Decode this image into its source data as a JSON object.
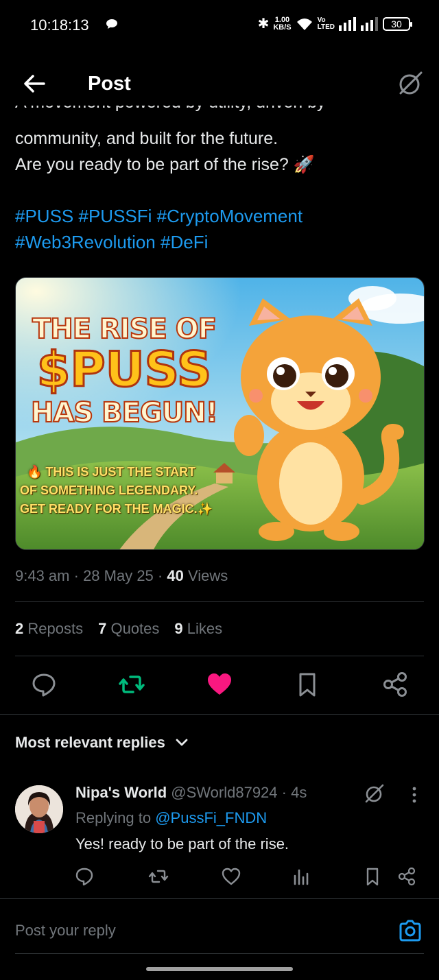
{
  "status_bar": {
    "time": "10:18:13",
    "net_speed_value": "1.00",
    "net_speed_unit": "KB/S",
    "volte_top": "Vo",
    "volte_bottom": "LTED",
    "battery": "30"
  },
  "header": {
    "title": "Post",
    "back_icon": "arrow-left-icon",
    "grok_icon": "grok-icon"
  },
  "post": {
    "text_clipped": "A movement powered by utility, driven by",
    "text_line2": "community, and built for the future.",
    "text_line3": "Are you ready to be part of the rise? 🚀",
    "hashtags": [
      "#PUSS",
      "#PUSSFi",
      "#CryptoMovement",
      "#Web3Revolution",
      "#DeFi"
    ],
    "media": {
      "line1": "THE RISE OF",
      "line2": "$PUSS",
      "line3": "HAS BEGUN!",
      "line4": "🔥 THIS IS JUST THE START",
      "line5": "OF SOMETHING LEGENDARY.",
      "line6": "GET READY FOR THE MAGIC.✨"
    },
    "time": "9:43 am",
    "date": "28 May 25",
    "views_count": "40",
    "views_label": "Views",
    "reposts_count": "2",
    "reposts_label": "Reposts",
    "quotes_count": "7",
    "quotes_label": "Quotes",
    "likes_count": "9",
    "likes_label": "Likes",
    "colors": {
      "accent": "#1d9bf0",
      "repost": "#00ba7c",
      "like": "#f91880"
    }
  },
  "replies": {
    "sort_label": "Most relevant replies",
    "items": [
      {
        "name": "Nipa's World",
        "handle": "@SWorld87924",
        "age": "· 4s",
        "replying_prefix": "Replying to",
        "replying_to": "@PussFi_FNDN",
        "text": "Yes! ready to be part of the rise."
      }
    ]
  },
  "compose": {
    "placeholder": "Post your reply"
  }
}
